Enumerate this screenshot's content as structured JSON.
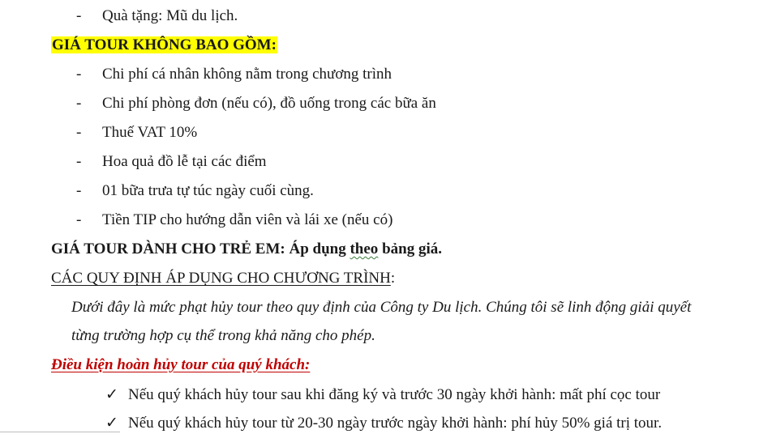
{
  "gift_line": "Quà tặng: Mũ du lịch.",
  "not_included": {
    "heading": "GIÁ TOUR KHÔNG BAO GỒM:",
    "items": [
      "Chi phí cá nhân không nằm trong chương trình",
      "Chi phí phòng đơn (nếu có), đồ uống trong các bữa ăn",
      "Thuế VAT 10%",
      "Hoa quả đồ lễ tại các điểm",
      "01 bữa trưa tự túc ngày cuối cùng.",
      "Tiền TIP cho hướng dẫn viên và lái xe (nếu có)"
    ]
  },
  "children_price": {
    "label": "GIÁ TOUR DÀNH CHO TRẺ EM: ",
    "value_prefix": "Áp dụng ",
    "value_wavy": "theo",
    "value_suffix": " bảng giá."
  },
  "rules": {
    "heading": "CÁC QUY ĐỊNH ÁP DỤNG CHO CHƯƠNG TRÌNH",
    "heading_suffix": ":",
    "paragraph_line1": "Dưới đây là mức phạt hủy tour theo quy định của Công ty Du lịch. Chúng tôi sẽ linh động giải quyết",
    "paragraph_line2": "từng trường hợp cụ thể trong khả năng cho phép."
  },
  "cancellation": {
    "heading": "Điều kiện hoàn hủy tour  của quý khách:",
    "items": [
      "Nếu quý khách hủy tour sau khi đăng ký và trước 30 ngày khởi hành: mất phí cọc tour",
      "Nếu quý khách hủy tour từ 20-30 ngày trước ngày khởi hành: phí hủy 50% giá trị tour."
    ]
  },
  "glyphs": {
    "dash": "-",
    "check": "✓"
  }
}
